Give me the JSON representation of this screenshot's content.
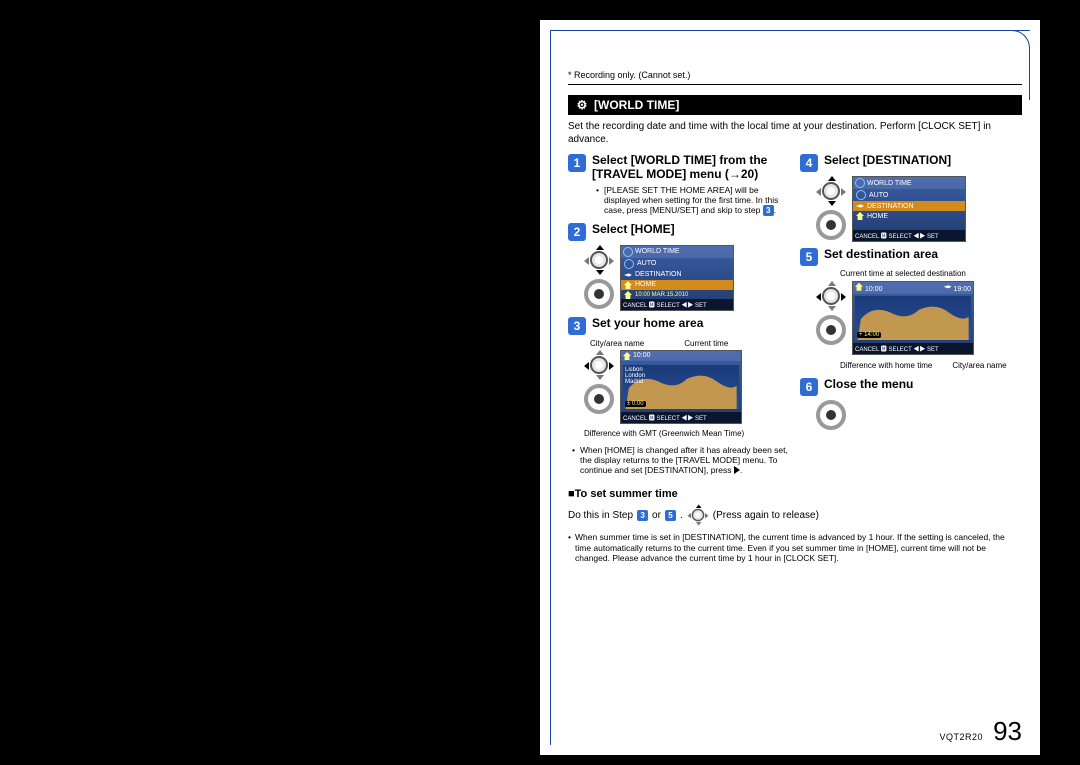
{
  "footnote_top": "* Recording only. (Cannot set.)",
  "section_title": "[WORLD TIME]",
  "section_icon": "⚙",
  "intro": "Set the recording date and time with the local time at your destination. Perform [CLOCK SET] in advance.",
  "left": {
    "step1": {
      "num": "1",
      "title": "Select [WORLD TIME] from the [TRAVEL MODE] menu (→20)",
      "bullet_a": "[PLEASE SET THE HOME AREA] will be displayed when setting for the first time. In this case, press [MENU/SET] and skip to step",
      "bullet_a_ref": "3",
      "bullet_a_tail": "."
    },
    "step2": {
      "num": "2",
      "title": "Select [HOME]",
      "lcd": {
        "header": "WORLD TIME",
        "rows": {
          "auto": "AUTO",
          "dest": "DESTINATION",
          "home": "HOME"
        },
        "status": "10:00  MAR.15.2010",
        "footer": "CANCEL 🅼 SELECT ◀▶ SET"
      }
    },
    "step3": {
      "num": "3",
      "title": "Set your home area",
      "label_left": "City/area name",
      "label_right": "Current time",
      "lcd": {
        "top_left": "10:00",
        "city": "Lisbon\nLondon\nMadrid",
        "tag": "± 0:00",
        "footer": "CANCEL 🅼 SELECT ◀▶ SET"
      },
      "caption": "Difference with GMT (Greenwich Mean Time)",
      "bullet": "When [HOME] is changed after it has already been set, the display returns to the [TRAVEL MODE] menu. To continue and set [DESTINATION], press"
    }
  },
  "right": {
    "step4": {
      "num": "4",
      "title": "Select [DESTINATION]",
      "lcd": {
        "header": "WORLD TIME",
        "rows": {
          "auto": "AUTO",
          "dest": "DESTINATION",
          "home": "HOME"
        },
        "footer": "CANCEL 🅼 SELECT ◀▶ SET"
      }
    },
    "step5": {
      "num": "5",
      "title": "Set destination area",
      "caption_top": "Current time at selected destination",
      "lcd": {
        "top_left": "10:00",
        "top_right": "19:00",
        "tag": "+ 14:00",
        "footer": "CANCEL 🅼 SELECT ◀▶ SET"
      },
      "label_left": "Difference with home time",
      "label_right": "City/area name"
    },
    "step6": {
      "num": "6",
      "title": "Close the menu"
    }
  },
  "summer": {
    "heading": "■To set summer time",
    "line_a": "Do this in Step",
    "ref1": "3",
    "line_mid": "or",
    "ref2": "5",
    "line_b": ".",
    "line_c": "(Press again to release)",
    "note": "When summer time is set in [DESTINATION], the current time is advanced by 1 hour. If the setting is canceled, the time automatically returns to the current time. Even if you set summer time in [HOME], current time will not be changed. Please advance the current time by 1 hour in [CLOCK SET]."
  },
  "footer": {
    "code": "VQT2R20",
    "page": "93"
  }
}
